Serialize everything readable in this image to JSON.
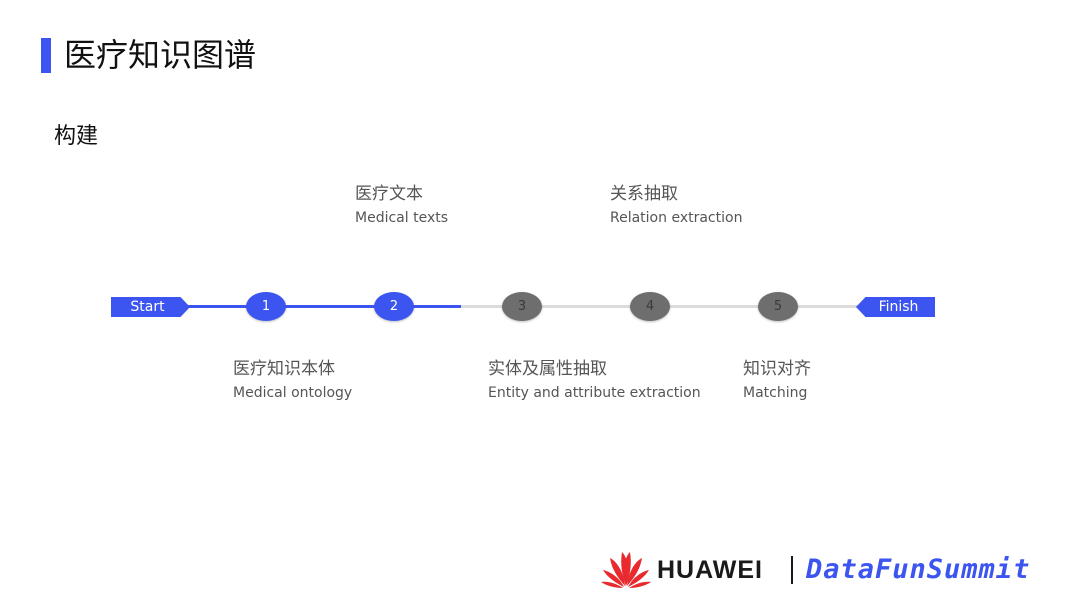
{
  "title": "医疗知识图谱",
  "subtitle": "构建",
  "timeline": {
    "start_label": "Start",
    "finish_label": "Finish",
    "nodes": [
      {
        "number": "1",
        "status": "done"
      },
      {
        "number": "2",
        "status": "done"
      },
      {
        "number": "3",
        "status": "pending"
      },
      {
        "number": "4",
        "status": "pending"
      },
      {
        "number": "5",
        "status": "pending"
      }
    ],
    "steps": [
      {
        "zh": "医疗知识本体",
        "en": "Medical ontology"
      },
      {
        "zh": "医疗文本",
        "en": "Medical texts"
      },
      {
        "zh": "实体及属性抽取",
        "en": "Entity and attribute extraction"
      },
      {
        "zh": "关系抽取",
        "en": "Relation extraction"
      },
      {
        "zh": "知识对齐",
        "en": "Matching"
      }
    ]
  },
  "colors": {
    "accent": "#3d55f0",
    "pending": "#6e6e6e",
    "track": "#dcdcdc",
    "logo_red": "#e8292e"
  },
  "footer": {
    "brand": "HUAWEI",
    "event": "DataFunSummit"
  }
}
